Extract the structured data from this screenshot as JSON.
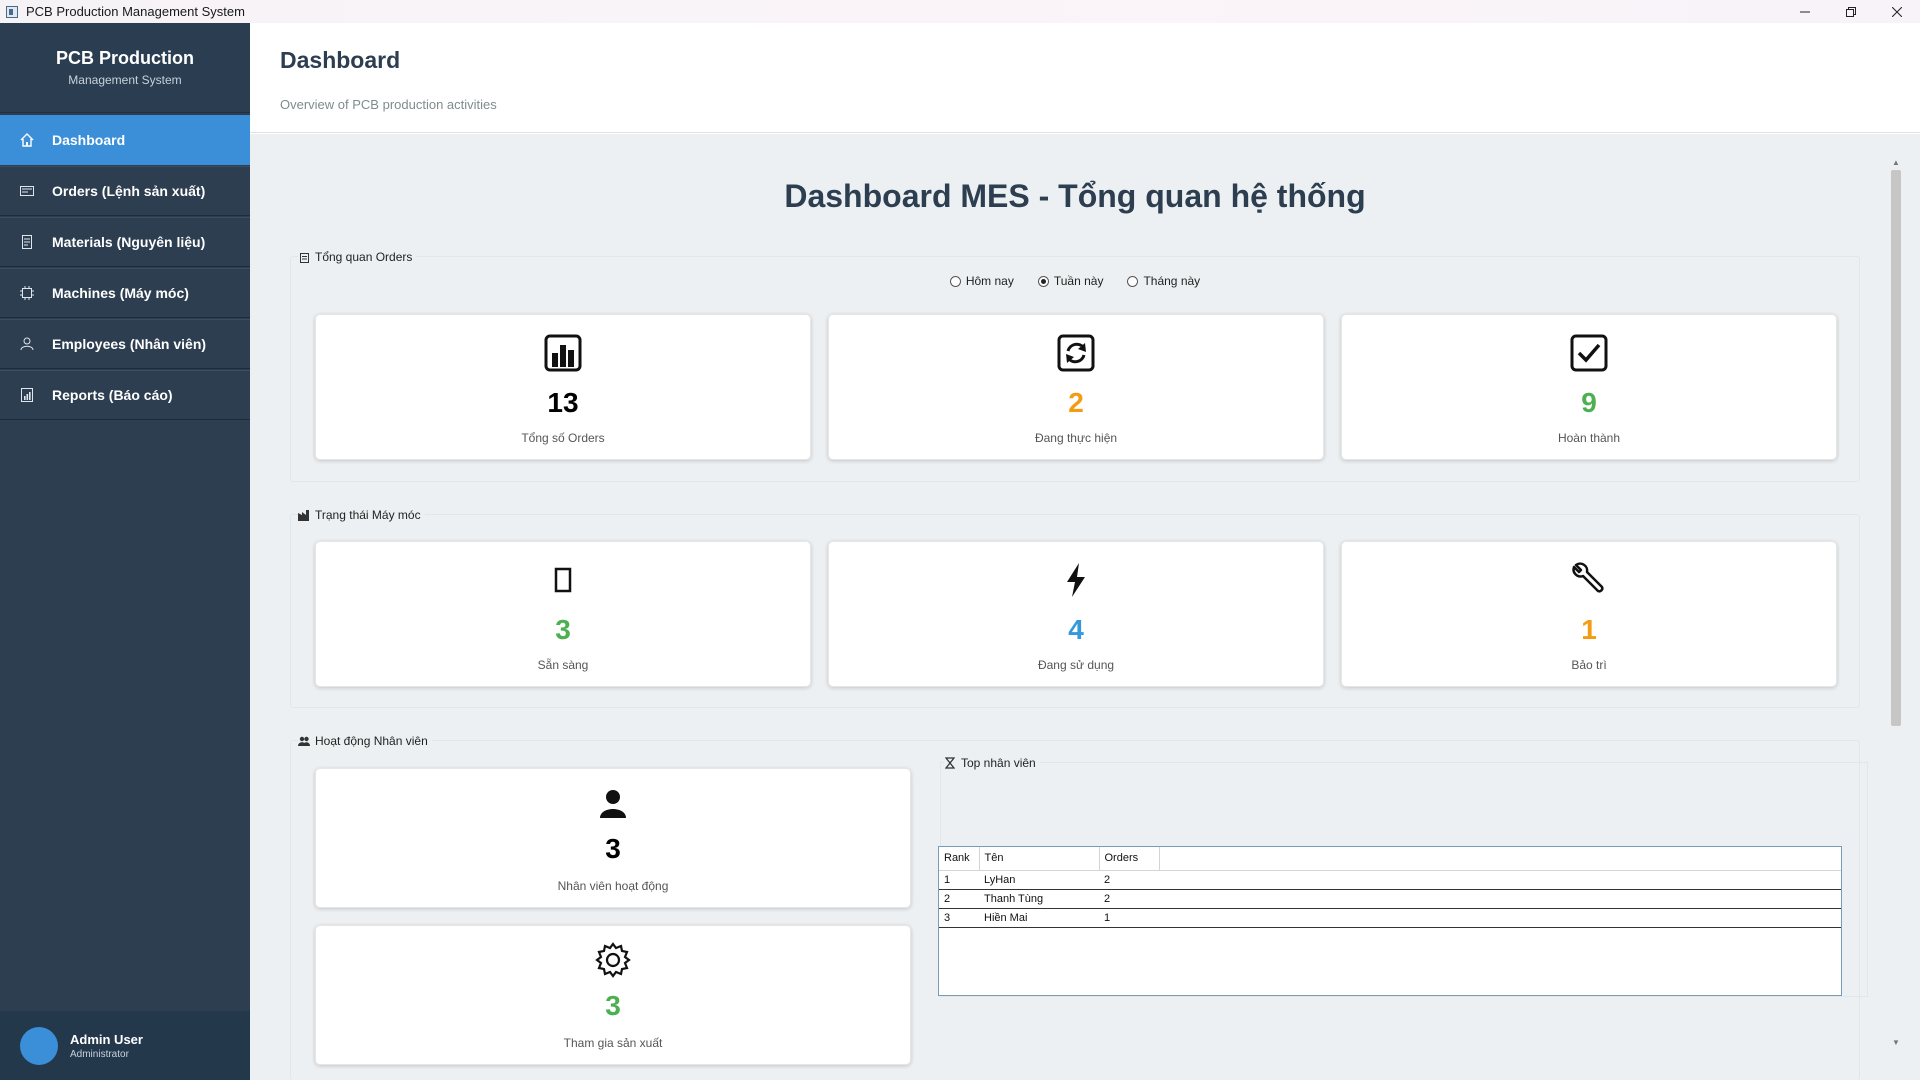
{
  "window": {
    "title": "PCB Production Management System",
    "controls": [
      "minimize",
      "restore",
      "close"
    ]
  },
  "sidebar": {
    "brand_title": "PCB Production",
    "brand_subtitle": "Management System",
    "items": [
      {
        "label": "Dashboard",
        "icon": "home-icon",
        "active": true
      },
      {
        "label": "Orders (Lệnh sản xuất)",
        "icon": "orders-icon",
        "active": false
      },
      {
        "label": "Materials (Nguyên liệu)",
        "icon": "materials-icon",
        "active": false
      },
      {
        "label": "Machines (Máy móc)",
        "icon": "chip-icon",
        "active": false
      },
      {
        "label": "Employees (Nhân viên)",
        "icon": "employee-icon",
        "active": false
      },
      {
        "label": "Reports (Báo cáo)",
        "icon": "report-icon",
        "active": false
      }
    ],
    "user": {
      "name": "Admin User",
      "role": "Administrator"
    }
  },
  "header": {
    "title": "Dashboard",
    "subtitle": "Overview of PCB production activities"
  },
  "main": {
    "title": "Dashboard MES - Tổng quan hệ thống",
    "orders": {
      "label": "Tổng quan Orders",
      "filters": [
        {
          "label": "Hôm nay",
          "checked": false
        },
        {
          "label": "Tuần này",
          "checked": true
        },
        {
          "label": "Tháng này",
          "checked": false
        }
      ],
      "cards": [
        {
          "icon": "bar-chart-icon",
          "value": "13",
          "label": "Tổng số Orders",
          "color": "#111111"
        },
        {
          "icon": "refresh-icon",
          "value": "2",
          "label": "Đang thực hiện",
          "color": "#f39c12"
        },
        {
          "icon": "check-box-icon",
          "value": "9",
          "label": "Hoàn thành",
          "color": "#4caf50"
        }
      ]
    },
    "machines": {
      "label": "Trạng thái Máy móc",
      "cards": [
        {
          "icon": "device-icon",
          "value": "3",
          "label": "Sẵn sàng",
          "color": "#4caf50"
        },
        {
          "icon": "lightning-icon",
          "value": "4",
          "label": "Đang sử dụng",
          "color": "#3498db"
        },
        {
          "icon": "wrench-icon",
          "value": "1",
          "label": "Bảo trì",
          "color": "#f39c12"
        }
      ]
    },
    "employees": {
      "label": "Hoạt động Nhân viên",
      "cards": [
        {
          "icon": "person-icon",
          "value": "3",
          "label": "Nhân viên hoạt động",
          "color": "#111111"
        },
        {
          "icon": "gear-icon",
          "value": "3",
          "label": "Tham gia sản xuất",
          "color": "#4caf50"
        }
      ],
      "top": {
        "label": "Top nhân viên",
        "columns": [
          "Rank",
          "Tên",
          "Orders"
        ],
        "rows": [
          [
            "1",
            "LyHan",
            "2"
          ],
          [
            "2",
            "Thanh Tùng",
            "2"
          ],
          [
            "3",
            "Hiền Mai",
            "1"
          ]
        ]
      }
    }
  }
}
